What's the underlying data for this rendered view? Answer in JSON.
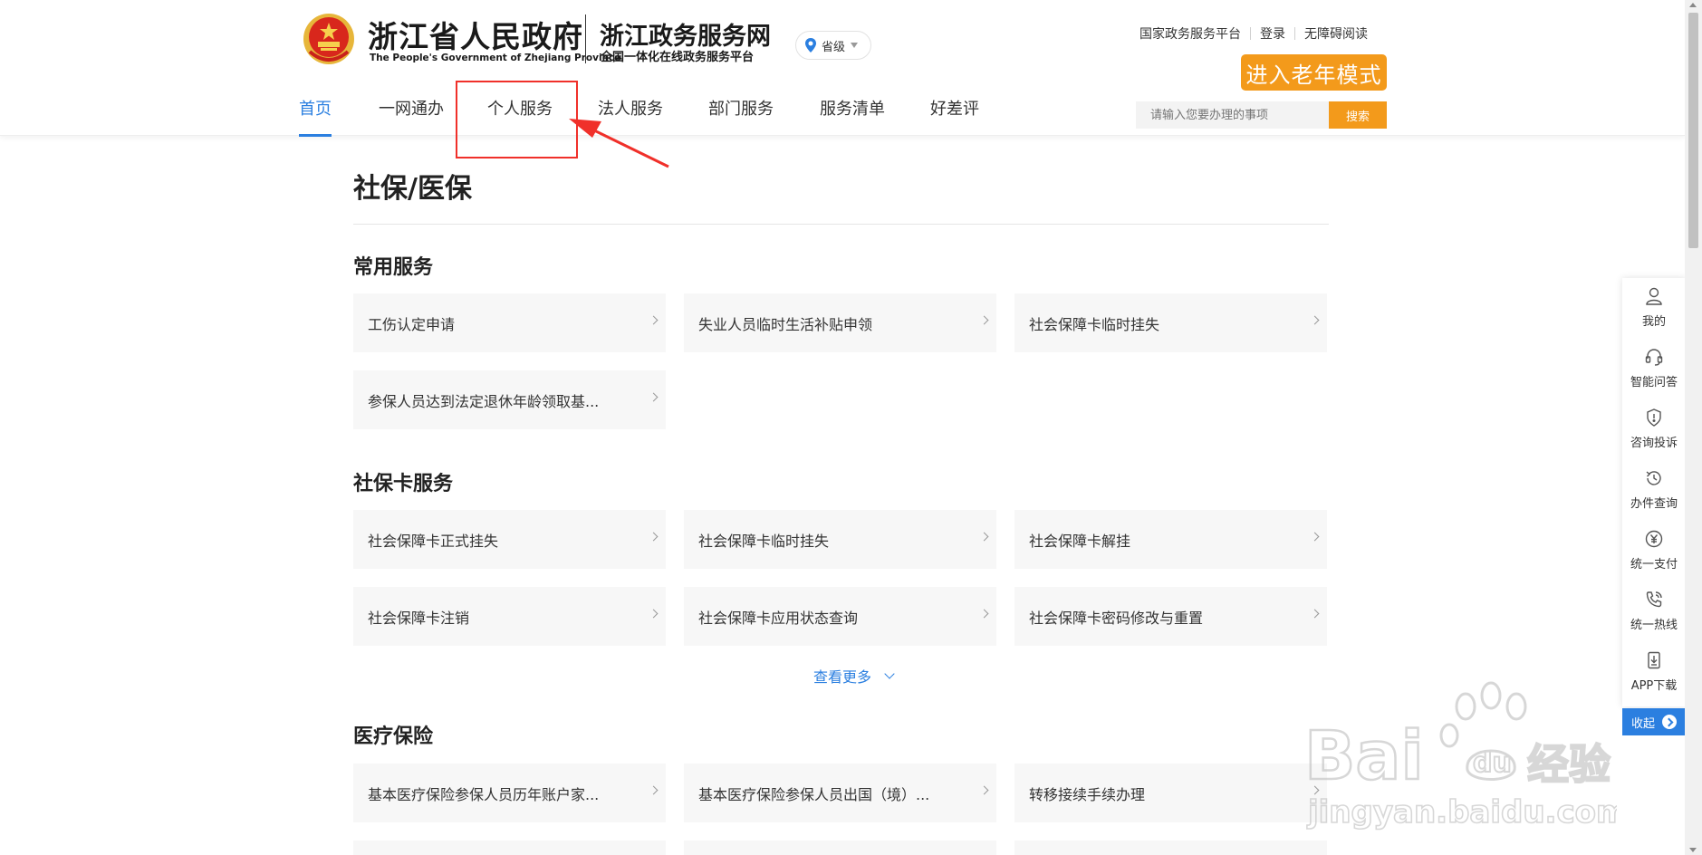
{
  "header": {
    "gov_title": "浙江省人民政府",
    "gov_subtitle": "The People's Government of Zhejiang Province",
    "site_title": "浙江政务服务网",
    "site_subtitle": "全国一体化在线政务服务平台",
    "region": "省级",
    "top_links": [
      "国家政务服务平台",
      "登录",
      "无障碍阅读"
    ],
    "elder_mode": "进入老年模式",
    "search_placeholder": "请输入您要办理的事项",
    "search_button": "搜索",
    "brand_color": "#2b7fe0",
    "accent_color": "#f39a1b"
  },
  "nav": {
    "items": [
      "首页",
      "一网通办",
      "个人服务",
      "法人服务",
      "部门服务",
      "服务清单",
      "好差评"
    ],
    "active": "首页",
    "highlighted": "个人服务"
  },
  "main": {
    "page_title": "社保/医保",
    "sections": [
      {
        "title": "常用服务",
        "items": [
          "工伤认定申请",
          "失业人员临时生活补贴申领",
          "社会保障卡临时挂失",
          "参保人员达到法定退休年龄领取基..."
        ]
      },
      {
        "title": "社保卡服务",
        "items": [
          "社会保障卡正式挂失",
          "社会保障卡临时挂失",
          "社会保障卡解挂",
          "社会保障卡注销",
          "社会保障卡应用状态查询",
          "社会保障卡密码修改与重置"
        ]
      },
      {
        "title": "医疗保险",
        "items": [
          "基本医疗保险参保人员历年账户家...",
          "基本医疗保险参保人员出国（境）...",
          "转移接续手续办理"
        ]
      }
    ],
    "more_label": "查看更多"
  },
  "sidebar": {
    "items": [
      {
        "label": "我的",
        "icon": "user-icon"
      },
      {
        "label": "智能问答",
        "icon": "headset-icon"
      },
      {
        "label": "咨询投诉",
        "icon": "shield-alert-icon"
      },
      {
        "label": "办件查询",
        "icon": "history-icon"
      },
      {
        "label": "统一支付",
        "icon": "yuan-icon"
      },
      {
        "label": "统一热线",
        "icon": "phone-icon"
      },
      {
        "label": "APP下载",
        "icon": "download-icon"
      }
    ],
    "collapse_label": "收起"
  },
  "watermark": {
    "brand": "Bai",
    "brand_mid": "du",
    "brand_cn": "经验",
    "url": "jingyan.baidu.com"
  }
}
